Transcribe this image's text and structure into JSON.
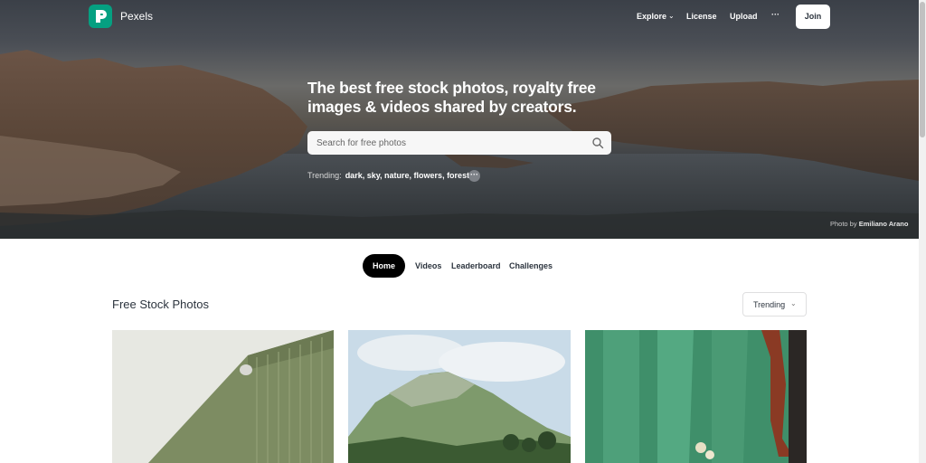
{
  "header": {
    "brand": "Pexels",
    "nav": {
      "explore": "Explore",
      "license": "License",
      "upload": "Upload",
      "more": "···",
      "join": "Join"
    }
  },
  "hero": {
    "headline": "The best free stock photos, royalty free images & videos shared by creators.",
    "search_placeholder": "Search for free photos",
    "trending_label": "Trending:",
    "trending_tags": "dark, sky, nature, flowers, forest",
    "more": "···",
    "credit_prefix": "Photo by",
    "credit_author": "Emiliano Arano"
  },
  "tabs": [
    "Home",
    "Videos",
    "Leaderboard",
    "Challenges"
  ],
  "main": {
    "section_title": "Free Stock Photos",
    "sort_value": "Trending"
  },
  "colors": {
    "brand": "#05a081",
    "active_tab": "#000000"
  },
  "icons": {
    "logo": "pexels-logo-icon",
    "search": "search-icon",
    "chevron": "chevron-down-icon"
  }
}
